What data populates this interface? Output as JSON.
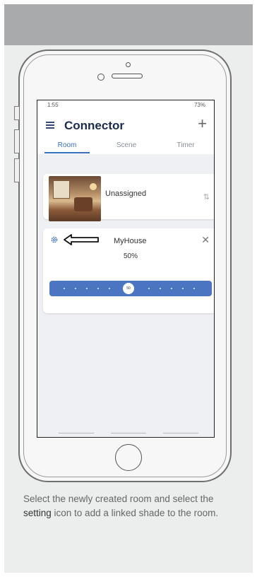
{
  "status": {
    "time": "1:55",
    "right": "73%"
  },
  "app": {
    "title": "Connector"
  },
  "tabs": [
    {
      "label": "Room",
      "active": true
    },
    {
      "label": "Scene",
      "active": false
    },
    {
      "label": "Timer",
      "active": false
    }
  ],
  "rooms": {
    "unassigned": {
      "name": "Unassigned"
    },
    "house": {
      "name": "MyHouse",
      "percent": "50%",
      "slider_value": 50,
      "knob_label": "50"
    }
  },
  "caption": {
    "part1": "Select the newly created room and select the ",
    "highlight": "setting",
    "part2": " icon to add a linked shade to the room."
  },
  "colors": {
    "accent": "#4b74c2",
    "title": "#1b2a4e",
    "band": "#a9aaac"
  },
  "icons": [
    "menu-icon",
    "plus-icon",
    "sort-icon",
    "gear-icon",
    "arrow-icon",
    "close-icon"
  ]
}
